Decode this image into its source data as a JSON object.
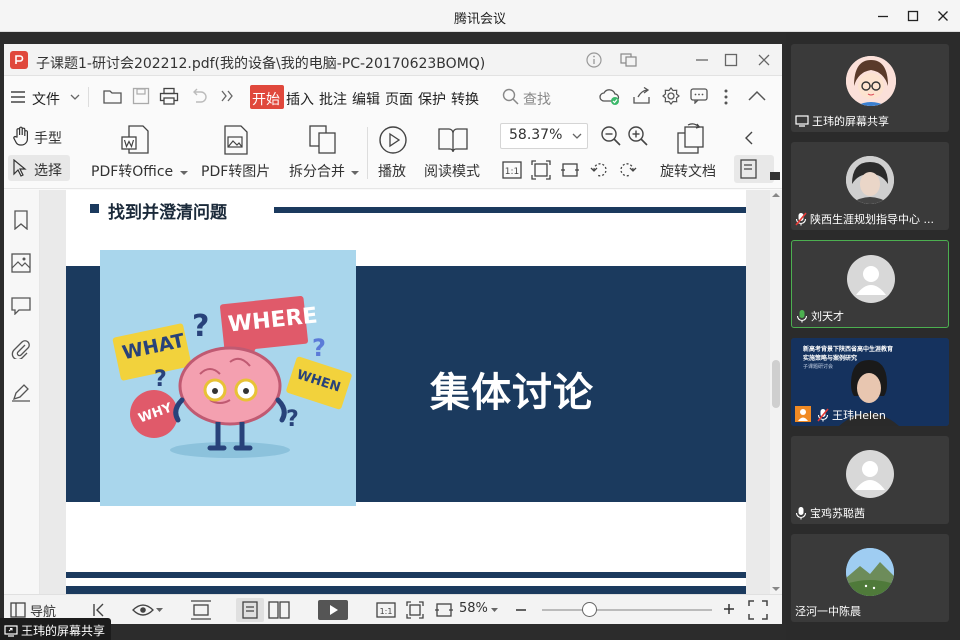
{
  "window": {
    "title": "腾讯会议"
  },
  "pdf": {
    "title": "子课题1-研讨会202212.pdf(我的设备\\我的电脑-PC-20170623BOMQ)",
    "menu": {
      "file": "文件",
      "tabs": [
        "开始",
        "插入",
        "批注",
        "编辑",
        "页面",
        "保护",
        "转换"
      ],
      "search": "查找"
    },
    "toolbar": {
      "hand": "手型",
      "select": "选择",
      "pdf_to_office": "PDF转Office",
      "pdf_to_image": "PDF转图片",
      "split_merge": "拆分合并",
      "play": "播放",
      "read_mode": "阅读模式",
      "zoom": "58.37%",
      "rotate": "旋转文档"
    },
    "slide": {
      "heading": "找到并澄清问题",
      "main_text": "集体讨论",
      "bubbles": [
        "WHAT",
        "WHERE",
        "WHY",
        "WHEN"
      ]
    },
    "status": {
      "nav": "导航",
      "zoom": "58%"
    }
  },
  "participants": [
    {
      "name": "王玮的屏幕共享",
      "mic": "screen"
    },
    {
      "name": "陕西生涯规划指导中心 ...",
      "mic": "muted"
    },
    {
      "name": "刘天才",
      "mic": "active"
    },
    {
      "name": "王玮Helen",
      "mic": "muted"
    },
    {
      "name": "宝鸡苏聪茜",
      "mic": "on"
    },
    {
      "name": "泾河一中陈晨",
      "mic": "none"
    }
  ],
  "helen_slide": {
    "line1": "新高考背景下陕西省高中生涯教育",
    "line2": "实施策略与案例研究",
    "line3": "子课题研讨会"
  },
  "share_tag": "王玮的屏幕共享",
  "colors": {
    "navy": "#1b3a5e",
    "accent": "#e0483c",
    "active_border": "#4caf50"
  }
}
